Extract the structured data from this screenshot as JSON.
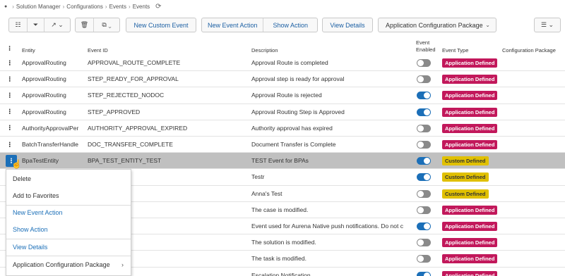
{
  "breadcrumb": {
    "items": [
      "Solution Manager",
      "Configurations",
      "Events",
      "Events"
    ]
  },
  "toolbar": {
    "new_custom_event": "New Custom Event",
    "new_event_action": "New Event Action",
    "show_action": "Show Action",
    "view_details": "View Details",
    "package_select": "Application Configuration Package"
  },
  "table": {
    "headers": {
      "entity": "Entity",
      "event_id": "Event ID",
      "description": "Description",
      "event_enabled": "Event Enabled",
      "event_type": "Event Type",
      "config_package": "Configuration Package"
    },
    "rows": [
      {
        "entity": "ApprovalRouting",
        "event_id": "APPROVAL_ROUTE_COMPLETE",
        "description": "Approval Route is completed",
        "enabled": false,
        "type": "Application Defined"
      },
      {
        "entity": "ApprovalRouting",
        "event_id": "STEP_READY_FOR_APPROVAL",
        "description": "Approval step is ready for approval",
        "enabled": false,
        "type": "Application Defined"
      },
      {
        "entity": "ApprovalRouting",
        "event_id": "STEP_REJECTED_NODOC",
        "description": "Approval Route is rejected",
        "enabled": true,
        "type": "Application Defined"
      },
      {
        "entity": "ApprovalRouting",
        "event_id": "STEP_APPROVED",
        "description": "Approval Routing Step is Approved",
        "enabled": true,
        "type": "Application Defined"
      },
      {
        "entity": "AuthorityApprovalPer",
        "event_id": "AUTHORITY_APPROVAL_EXPIRED",
        "description": "Authority approval has expired",
        "enabled": false,
        "type": "Application Defined"
      },
      {
        "entity": "BatchTransferHandle",
        "event_id": "DOC_TRANSFER_COMPLETE",
        "description": "Document Transfer is Complete",
        "enabled": false,
        "type": "Application Defined"
      },
      {
        "entity": "BpaTestEntity",
        "event_id": "BPA_TEST_ENTITY_TEST",
        "description": "TEST Event for BPAs",
        "enabled": true,
        "type": "Custom Defined",
        "selected": true
      },
      {
        "entity": "",
        "event_id": "LEAD",
        "description": "Testr",
        "enabled": true,
        "type": "Custom Defined"
      },
      {
        "entity": "",
        "event_id": "",
        "description": "Anna's Test",
        "enabled": false,
        "type": "Custom Defined"
      },
      {
        "entity": "",
        "event_id": "D",
        "description": "The case is modified.",
        "enabled": false,
        "type": "Application Defined"
      },
      {
        "entity": "",
        "event_id": "ER_1_1",
        "description": "Event used for Aurena Native push notifications. Do not c",
        "enabled": true,
        "type": "Application Defined"
      },
      {
        "entity": "",
        "event_id": "ODIFIED",
        "description": "The solution is modified.",
        "enabled": false,
        "type": "Application Defined"
      },
      {
        "entity": "",
        "event_id": "D",
        "description": "The task is modified.",
        "enabled": false,
        "type": "Application Defined"
      },
      {
        "entity": "CcFeebNotification",
        "event_id": "NOTIFICATION",
        "description": "Escalation Notification",
        "enabled": true,
        "type": "Application Defined"
      }
    ]
  },
  "context_menu": {
    "delete": "Delete",
    "add_favorites": "Add to Favorites",
    "new_event_action": "New Event Action",
    "show_action": "Show Action",
    "view_details": "View Details",
    "app_config_package": "Application Configuration Package"
  },
  "colors": {
    "accent": "#1b6fb8",
    "app_defined_badge": "#c2185b",
    "custom_defined_badge": "#e0c000"
  }
}
